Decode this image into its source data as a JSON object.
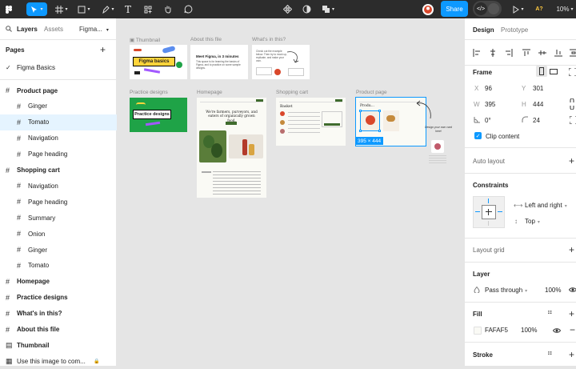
{
  "toolbar": {
    "zoom": "10%",
    "share_label": "Share",
    "avatar_initial": "A?",
    "accent": "#0d99ff",
    "icons": [
      "figma-menu-icon",
      "move-tool-icon",
      "frame-tool-icon",
      "shape-tool-icon",
      "pen-tool-icon",
      "text-tool-icon",
      "resources-icon",
      "hand-tool-icon",
      "comment-tool-icon",
      "components-icon",
      "mask-icon",
      "boolean-icon",
      "user-avatar-icon",
      "dev-mode-icon",
      "present-icon"
    ]
  },
  "left_panel": {
    "tabs": {
      "layers": "Layers",
      "assets": "Assets",
      "file": "Figma..."
    },
    "pages_title": "Pages",
    "current_page": "Figma Basics",
    "layers": [
      {
        "label": "Product page",
        "type": "frame",
        "level": 0
      },
      {
        "label": "Ginger",
        "type": "frame",
        "level": 1
      },
      {
        "label": "Tomato",
        "type": "frame",
        "level": 1,
        "selected": true
      },
      {
        "label": "Navigation",
        "type": "frame",
        "level": 1
      },
      {
        "label": "Page heading",
        "type": "frame",
        "level": 1
      },
      {
        "label": "Shopping cart",
        "type": "frame",
        "level": 0
      },
      {
        "label": "Navigation",
        "type": "frame",
        "level": 1
      },
      {
        "label": "Page heading",
        "type": "frame",
        "level": 1
      },
      {
        "label": "Summary",
        "type": "frame",
        "level": 1
      },
      {
        "label": "Onion",
        "type": "frame",
        "level": 1
      },
      {
        "label": "Ginger",
        "type": "frame",
        "level": 1
      },
      {
        "label": "Tomato",
        "type": "frame",
        "level": 1
      },
      {
        "label": "Homepage",
        "type": "frame",
        "level": 0
      },
      {
        "label": "Practice designs",
        "type": "frame",
        "level": 0
      },
      {
        "label": "What's in this?",
        "type": "frame",
        "level": 0
      },
      {
        "label": "About this file",
        "type": "frame",
        "level": 0
      },
      {
        "label": "Thumbnail",
        "type": "component",
        "level": 0
      },
      {
        "label": "Use this image to com...",
        "type": "locked",
        "level": 0
      }
    ]
  },
  "canvas": {
    "frames": {
      "thumbnail": "Thumbnail",
      "about": "About this file",
      "whats_in": "What's in this?",
      "practice": "Practice designs",
      "homepage": "Homepage",
      "cart": "Shopping cart",
      "product": "Product page"
    },
    "thumb_text": "Figma basics",
    "about_title": "Meet Figma, in 3 minutes",
    "about_body": "This space is for learning the basics of Figma, and to practice on some sample designs.",
    "whats_body": "Check out the example below. Then try to mock up, replicate, and make your own.",
    "practice_text": "Practice designs",
    "home_heading": "We're farmers, purveyors, and eaters of organically grown food.",
    "cart_heading": "Basket",
    "product_heading": "Produ...",
    "annotation": "Design your own card here!",
    "selection_size": "395 × 444"
  },
  "right_panel": {
    "tabs": {
      "design": "Design",
      "prototype": "Prototype"
    },
    "frame_label": "Frame",
    "x_label": "X",
    "x": "96",
    "y_label": "Y",
    "y": "301",
    "w_label": "W",
    "w": "395",
    "h_label": "H",
    "h": "444",
    "rotation": "0°",
    "radius": "24",
    "clip_label": "Clip content",
    "auto_layout": "Auto layout",
    "constraints": "Constraints",
    "horizontal": "Left and right",
    "vertical": "Top",
    "layout_grid": "Layout grid",
    "layer": "Layer",
    "blend": "Pass through",
    "opacity": "100%",
    "fill": "Fill",
    "fill_hex": "FAFAF5",
    "fill_opacity": "100%",
    "stroke": "Stroke"
  },
  "colors": {
    "toolbar_bg": "#2c2c2c",
    "selection": "#0d99ff",
    "selected_row": "#e5f4ff",
    "thumb_yellow": "#ffd43b",
    "practice_green": "#1fa347",
    "leaf_green": "#3f6b2d",
    "tomato_red": "#d9472b"
  }
}
